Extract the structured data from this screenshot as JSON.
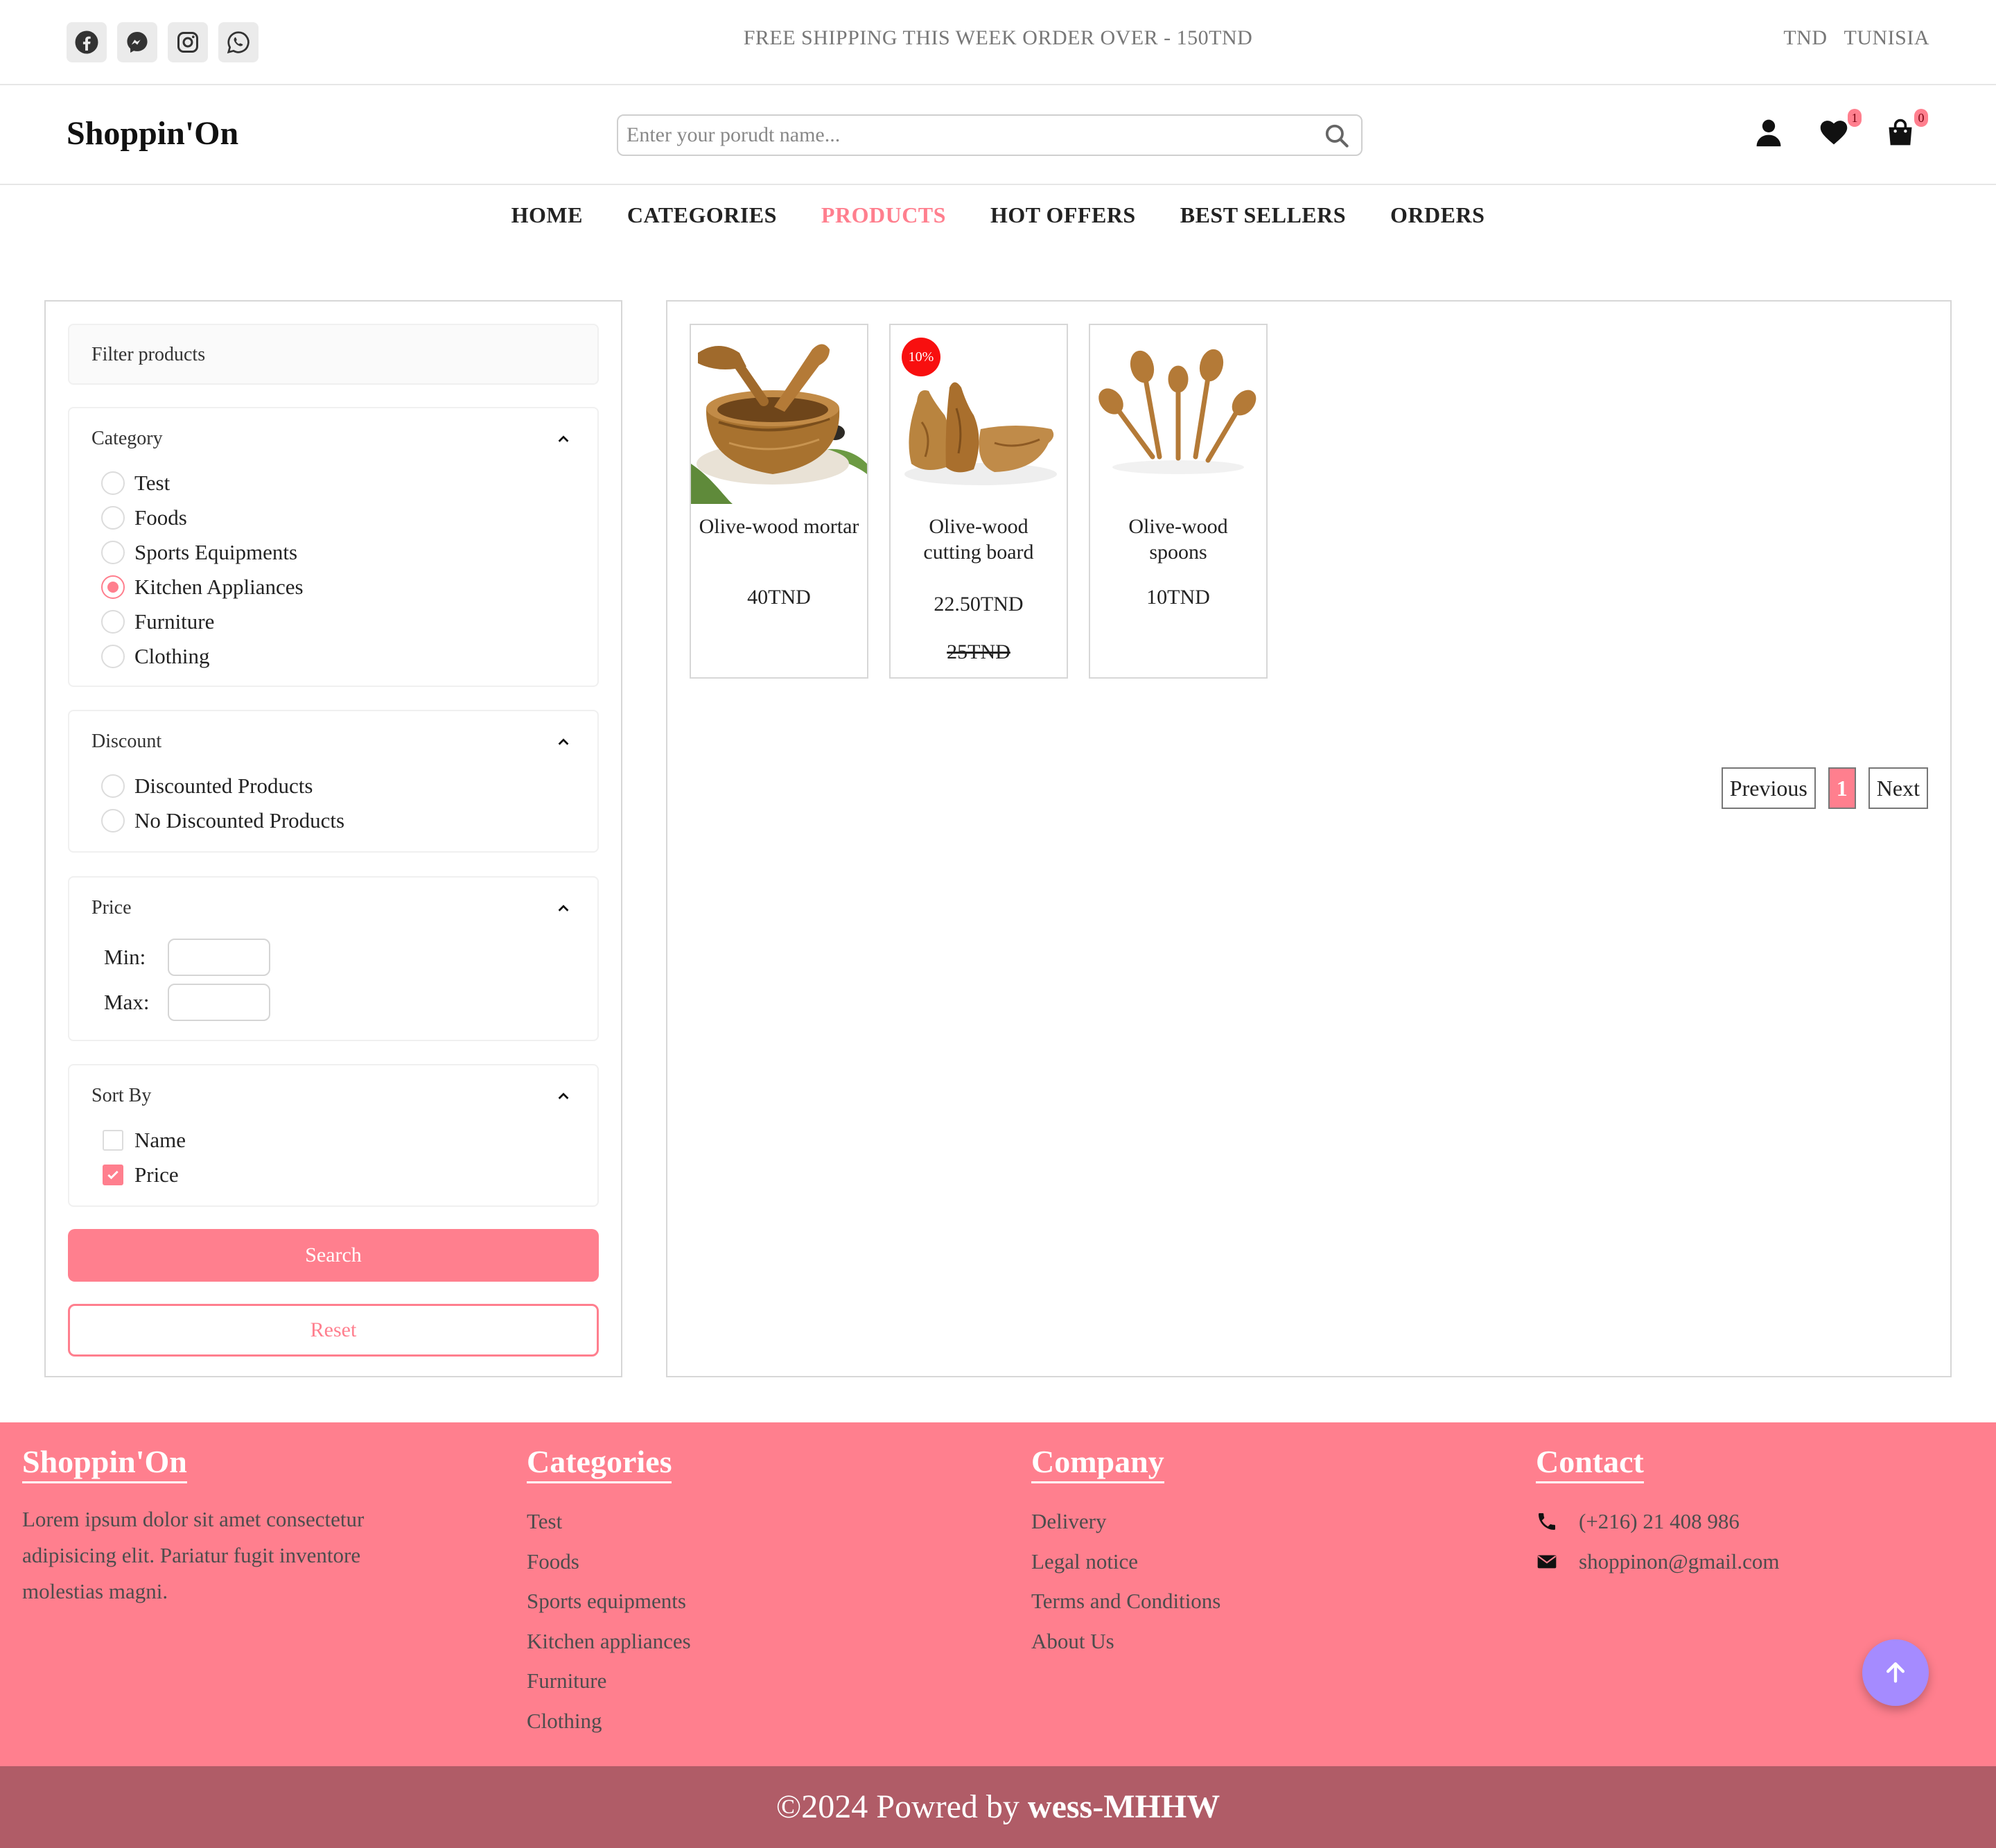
{
  "topbar": {
    "socials": [
      {
        "icon": "facebook-icon"
      },
      {
        "icon": "messenger-icon"
      },
      {
        "icon": "instagram-icon"
      },
      {
        "icon": "whatsapp-icon"
      }
    ],
    "promo": "FREE SHIPPING THIS WEEK ORDER OVER - 150TND",
    "currency": "TND",
    "country": "TUNISIA"
  },
  "header": {
    "brand": "Shoppin'On",
    "search_placeholder": "Enter your porudt name...",
    "wishlist_count": "1",
    "cart_count": "0"
  },
  "nav": {
    "items": [
      "HOME",
      "CATEGORIES",
      "PRODUCTS",
      "HOT OFFERS",
      "BEST SELLERS",
      "ORDERS"
    ],
    "active": "PRODUCTS"
  },
  "filter": {
    "title": "Filter products",
    "category": {
      "heading": "Category",
      "options": [
        "Test",
        "Foods",
        "Sports Equipments",
        "Kitchen Appliances",
        "Furniture",
        "Clothing"
      ],
      "selected": "Kitchen Appliances"
    },
    "discount": {
      "heading": "Discount",
      "options": [
        "Discounted Products",
        "No Discounted Products"
      ]
    },
    "price": {
      "heading": "Price",
      "min_label": "Min:",
      "max_label": "Max:",
      "min_value": "",
      "max_value": ""
    },
    "sort": {
      "heading": "Sort By",
      "options": [
        "Name",
        "Price"
      ],
      "checked": "Price"
    },
    "search_label": "Search",
    "reset_label": "Reset"
  },
  "products": [
    {
      "name": "Olive-wood mortar",
      "price": "40TND"
    },
    {
      "name": "Olive-wood cutting board",
      "price": "22.50TND",
      "old_price": "25TND",
      "discount": "10%"
    },
    {
      "name": "Olive-wood spoons",
      "price": "10TND"
    }
  ],
  "pagination": {
    "previous": "Previous",
    "page": "1",
    "next": "Next"
  },
  "footer": {
    "brand": "Shoppin'On",
    "about": "Lorem ipsum dolor sit amet consectetur adipisicing elit. Pariatur fugit inventore molestias magni.",
    "categories_title": "Categories",
    "categories": [
      "Test",
      "Foods",
      "Sports equipments",
      "Kitchen appliances",
      "Furniture",
      "Clothing"
    ],
    "company_title": "Company",
    "company": [
      "Delivery",
      "Legal notice",
      "Terms and Conditions",
      "About Us"
    ],
    "contact_title": "Contact",
    "phone": "(+216) 21 408 986",
    "email": "shoppinon@gmail.com"
  },
  "copyright": {
    "prefix": "©2024 Powred by ",
    "author": "wess-MHHW"
  },
  "colors": {
    "accent": "#ff7f8e",
    "footer_bottom": "#b05c67",
    "discount_badge": "#f80f0f",
    "scroll_top": "#a58bff"
  }
}
